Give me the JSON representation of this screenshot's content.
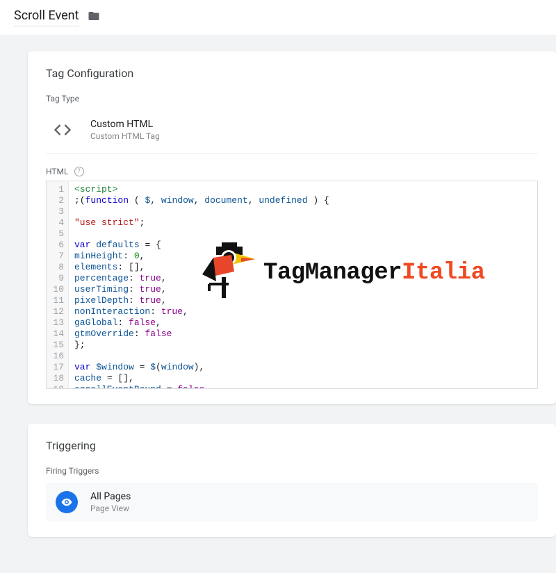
{
  "header": {
    "title": "Scroll Event"
  },
  "card_config": {
    "title": "Tag Configuration",
    "section_label": "Tag Type",
    "tag_type": {
      "name": "Custom HTML",
      "sub": "Custom HTML Tag"
    },
    "html_label": "HTML",
    "code_lines": [
      [
        [
          "tag",
          "<script>"
        ]
      ],
      [
        [
          "pun",
          ";("
        ],
        [
          "kw",
          "function"
        ],
        [
          "pun",
          " ( "
        ],
        [
          "var",
          "$"
        ],
        [
          "pun",
          ", "
        ],
        [
          "var",
          "window"
        ],
        [
          "pun",
          ", "
        ],
        [
          "var",
          "document"
        ],
        [
          "pun",
          ", "
        ],
        [
          "var",
          "undefined"
        ],
        [
          "pun",
          " ) {"
        ]
      ],
      [],
      [
        [
          "str",
          "\"use strict\""
        ],
        [
          "pun",
          ";"
        ]
      ],
      [],
      [
        [
          "kw",
          "var "
        ],
        [
          "var",
          "defaults"
        ],
        [
          "pun",
          " = {"
        ]
      ],
      [
        [
          "var",
          "minHeight"
        ],
        [
          "pun",
          ": "
        ],
        [
          "num",
          "0"
        ],
        [
          "pun",
          ","
        ]
      ],
      [
        [
          "var",
          "elements"
        ],
        [
          "pun",
          ": [],"
        ]
      ],
      [
        [
          "var",
          "percentage"
        ],
        [
          "pun",
          ": "
        ],
        [
          "bool",
          "true"
        ],
        [
          "pun",
          ","
        ]
      ],
      [
        [
          "var",
          "userTiming"
        ],
        [
          "pun",
          ": "
        ],
        [
          "bool",
          "true"
        ],
        [
          "pun",
          ","
        ]
      ],
      [
        [
          "var",
          "pixelDepth"
        ],
        [
          "pun",
          ": "
        ],
        [
          "bool",
          "true"
        ],
        [
          "pun",
          ","
        ]
      ],
      [
        [
          "var",
          "nonInteraction"
        ],
        [
          "pun",
          ": "
        ],
        [
          "bool",
          "true"
        ],
        [
          "pun",
          ","
        ]
      ],
      [
        [
          "var",
          "gaGlobal"
        ],
        [
          "pun",
          ": "
        ],
        [
          "bool",
          "false"
        ],
        [
          "pun",
          ","
        ]
      ],
      [
        [
          "var",
          "gtmOverride"
        ],
        [
          "pun",
          ": "
        ],
        [
          "bool",
          "false"
        ]
      ],
      [
        [
          "pun",
          "};"
        ]
      ],
      [],
      [
        [
          "kw",
          "var "
        ],
        [
          "var",
          "$window"
        ],
        [
          "pun",
          " = "
        ],
        [
          "var",
          "$"
        ],
        [
          "pun",
          "("
        ],
        [
          "var",
          "window"
        ],
        [
          "pun",
          "),"
        ]
      ],
      [
        [
          "var",
          "cache"
        ],
        [
          "pun",
          " = [],"
        ]
      ],
      [
        [
          "var",
          "scrollEventBound"
        ],
        [
          "pun",
          " = "
        ],
        [
          "bool",
          "false"
        ]
      ]
    ]
  },
  "watermark": {
    "main": "TagManager",
    "accent": "Italia"
  },
  "card_trigger": {
    "title": "Triggering",
    "section_label": "Firing Triggers",
    "trigger": {
      "name": "All Pages",
      "sub": "Page View"
    }
  }
}
